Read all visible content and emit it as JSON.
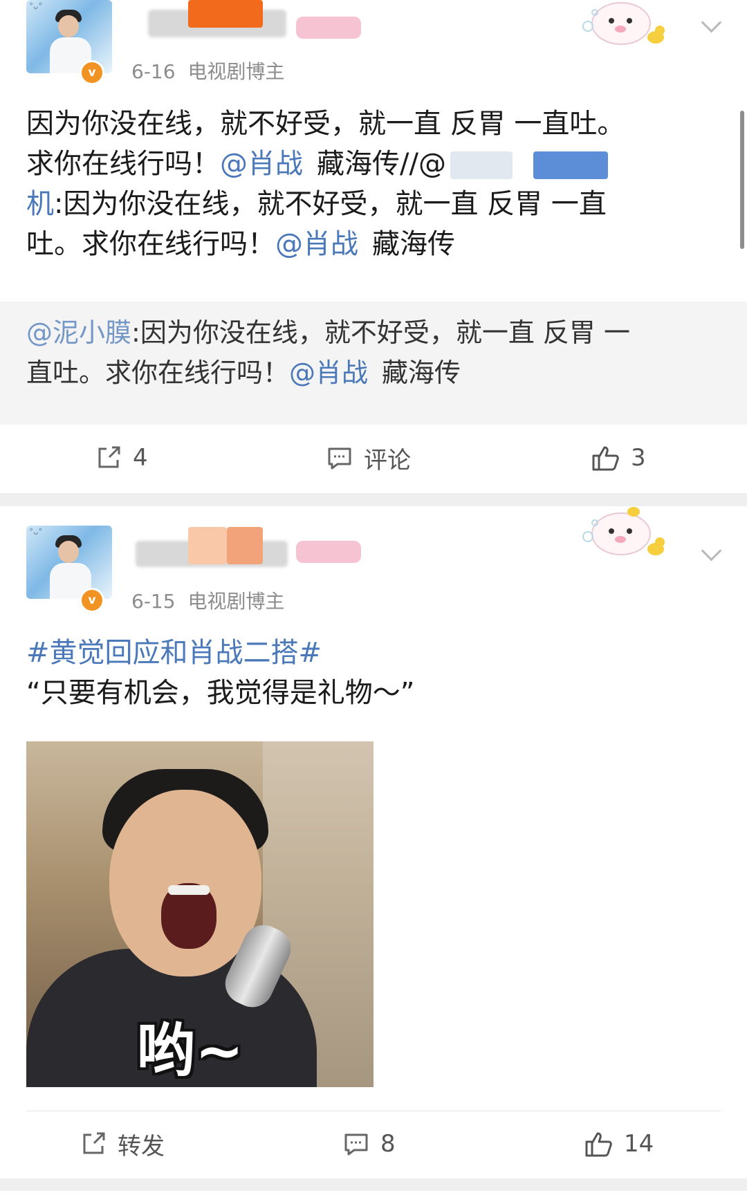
{
  "colors": {
    "link": "#4a78b8",
    "badge": "#f09322",
    "text": "#1b1b1b",
    "meta": "#8c8c8c"
  },
  "posts": [
    {
      "meta": {
        "date": "6-16",
        "role": "电视剧博主"
      },
      "body_lines": [
        {
          "text": "因为你没在线，就不好受，就一直 反胃 一直吐。"
        },
        {
          "a": "求你在线行吗！",
          "mention": "@肖战",
          "topic": "藏海传",
          "tail": "//@"
        },
        {
          "a": "机",
          "b": ":因为你没在线，就不好受，就一直 反胃 一直"
        },
        {
          "a": "吐。求你在线行吗！",
          "mention": "@肖战",
          "topic": "藏海传"
        }
      ],
      "repost": {
        "line1_name": "@泥小膜",
        "line1_text": ":因为你没在线，就不好受，就一直 反胃 一",
        "line2_text": "直吐。求你在线行吗！",
        "line2_mention": "@肖战",
        "line2_topic": "藏海传"
      },
      "actions": {
        "repost": "4",
        "comment": "评论",
        "like": "3"
      }
    },
    {
      "meta": {
        "date": "6-15",
        "role": "电视剧博主"
      },
      "hashtag": "#黄觉回应和肖战二搭#",
      "quote": "“只要有机会，我觉得是礼物～”",
      "image": {
        "caption": "哟~"
      },
      "actions": {
        "repost": "转发",
        "comment": "8",
        "like": "14"
      }
    }
  ],
  "icons": {
    "badge": "v-badge-icon",
    "repost": "share-icon",
    "comment": "comment-icon",
    "like": "thumbs-up-icon",
    "more": "chevron-down-icon"
  }
}
